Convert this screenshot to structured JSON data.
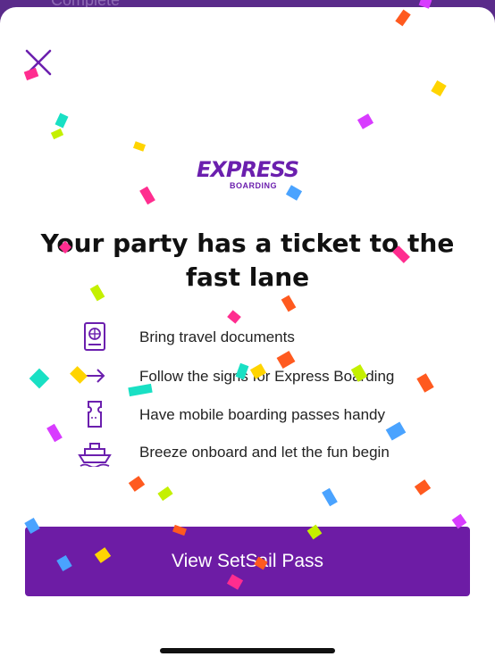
{
  "background_screen": {
    "partial_label": "Complete"
  },
  "modal": {
    "close_label": "",
    "logo": {
      "main": "EXPRESS",
      "sub": "BOARDING"
    },
    "headline": "Your party has a ticket to the fast lane",
    "features": [
      {
        "icon": "passport-icon",
        "text": "Bring travel documents"
      },
      {
        "icon": "arrow-right-icon",
        "text": "Follow the signs for Express Boarding"
      },
      {
        "icon": "ticket-icon",
        "text": "Have mobile boarding passes handy"
      },
      {
        "icon": "ship-icon",
        "text": "Breeze onboard and let the fun begin"
      }
    ],
    "cta_label": "View SetSail Pass"
  },
  "colors": {
    "brand_purple": "#6d1ca5",
    "background_purple": "#5b2a86",
    "confetti": [
      "#ff2d8f",
      "#ff5a1f",
      "#ffd400",
      "#c4f000",
      "#19e0c4",
      "#4aa3ff",
      "#d83cff"
    ]
  }
}
